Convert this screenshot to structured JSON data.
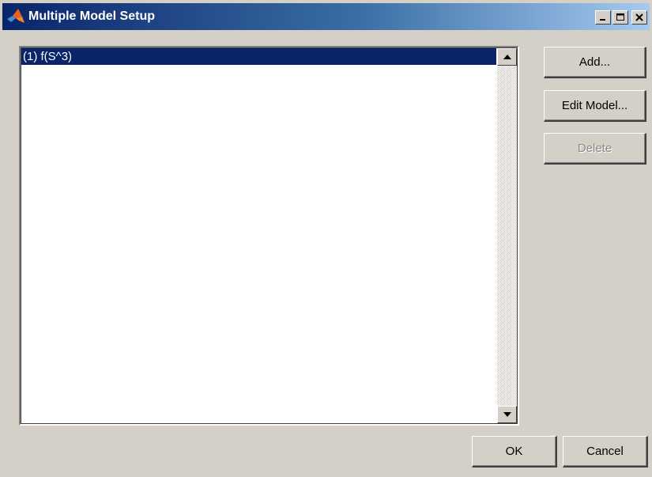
{
  "window": {
    "title": "Multiple Model Setup",
    "app_icon": "matlab-logo-icon",
    "controls": [
      "minimize-icon",
      "maximize-icon",
      "close-icon"
    ]
  },
  "model_list": {
    "items": [
      {
        "label": "(1)  f(S^3)",
        "selected": true
      }
    ]
  },
  "side_buttons": {
    "add_label": "Add...",
    "edit_label": "Edit Model...",
    "delete_label": "Delete"
  },
  "footer_buttons": {
    "ok_label": "OK",
    "cancel_label": "Cancel"
  },
  "colors": {
    "titlebar_start": "#0a246a",
    "titlebar_end": "#a6caf0",
    "selection": "#0a246a",
    "dialog_background": "#d4d0c8"
  }
}
